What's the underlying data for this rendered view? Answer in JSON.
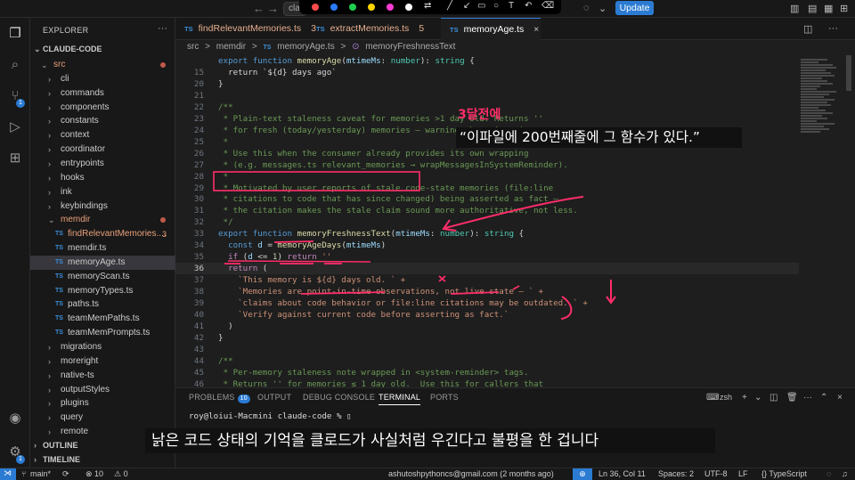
{
  "titlebar": {
    "search_value": "cla",
    "update_label": "Update",
    "annotation_colors": [
      "#ff4b4b",
      "#2b7bff",
      "#1fcf4f",
      "#ffd400",
      "#ff3bd4",
      "#ffffff"
    ],
    "nav_back": "←",
    "nav_forward": "→"
  },
  "activity": {
    "items": [
      {
        "icon": "explorer-icon",
        "glyph": "❐"
      },
      {
        "icon": "search-icon",
        "glyph": "⌕"
      },
      {
        "icon": "source-control-icon",
        "glyph": "⑂",
        "badge": "1"
      },
      {
        "icon": "run-debug-icon",
        "glyph": "▷"
      },
      {
        "icon": "extensions-icon",
        "glyph": "⊞"
      }
    ],
    "account_icon": "account-icon",
    "settings_icon": "gear-icon",
    "settings_badge": "1"
  },
  "explorer": {
    "header": "EXPLORER",
    "more": "···",
    "root": "CLAUDE-CODE",
    "items": [
      {
        "label": "src",
        "type": "folder",
        "open": true,
        "color": "#e8a07a",
        "dot": "#c05a4a"
      },
      {
        "label": "cli",
        "type": "folder"
      },
      {
        "label": "commands",
        "type": "folder"
      },
      {
        "label": "components",
        "type": "folder"
      },
      {
        "label": "constants",
        "type": "folder"
      },
      {
        "label": "context",
        "type": "folder"
      },
      {
        "label": "coordinator",
        "type": "folder"
      },
      {
        "label": "entrypoints",
        "type": "folder"
      },
      {
        "label": "hooks",
        "type": "folder"
      },
      {
        "label": "ink",
        "type": "folder"
      },
      {
        "label": "keybindings",
        "type": "folder"
      },
      {
        "label": "memdir",
        "type": "folder",
        "open": true,
        "color": "#e8a07a",
        "dot": "#c05a4a"
      },
      {
        "label": "findRelevantMemories....",
        "type": "file",
        "color": "#e8a07a",
        "mark": "3"
      },
      {
        "label": "memdir.ts",
        "type": "file"
      },
      {
        "label": "memoryAge.ts",
        "type": "file",
        "selected": true
      },
      {
        "label": "memoryScan.ts",
        "type": "file"
      },
      {
        "label": "memoryTypes.ts",
        "type": "file"
      },
      {
        "label": "paths.ts",
        "type": "file"
      },
      {
        "label": "teamMemPaths.ts",
        "type": "file"
      },
      {
        "label": "teamMemPrompts.ts",
        "type": "file"
      },
      {
        "label": "migrations",
        "type": "folder"
      },
      {
        "label": "moreright",
        "type": "folder"
      },
      {
        "label": "native-ts",
        "type": "folder"
      },
      {
        "label": "outputStyles",
        "type": "folder"
      },
      {
        "label": "plugins",
        "type": "folder"
      },
      {
        "label": "query",
        "type": "folder"
      },
      {
        "label": "remote",
        "type": "folder"
      }
    ],
    "file_badge": "TS",
    "outline": "OUTLINE",
    "timeline": "TIMELINE"
  },
  "tabs": [
    {
      "label": "findRelevantMemories.ts",
      "count": "3"
    },
    {
      "label": "extractMemories.ts",
      "count": "5"
    },
    {
      "label": "memoryAge.ts",
      "active": true,
      "close": "×"
    }
  ],
  "breadcrumb": [
    "src",
    ">",
    "memdir",
    ">",
    "TS",
    "memoryAge.ts",
    ">",
    "⊙",
    "memoryFreshnessText"
  ],
  "code": [
    {
      "n": "15",
      "t": [
        [
          "c-pl",
          "  return `${d} days ago`"
        ]
      ]
    },
    {
      "n": "20",
      "t": [
        [
          "c-pl",
          "}"
        ]
      ]
    },
    {
      "n": "21",
      "t": []
    },
    {
      "n": "22",
      "t": [
        [
          "c-cm",
          "/**"
        ]
      ]
    },
    {
      "n": "23",
      "t": [
        [
          "c-cm",
          " * Plain-text staleness caveat for memories >1 day old. Returns ''"
        ]
      ]
    },
    {
      "n": "24",
      "t": [
        [
          "c-cm",
          " * for fresh (today/yesterday) memories — warning there is noise."
        ]
      ]
    },
    {
      "n": "25",
      "t": [
        [
          "c-cm",
          " *"
        ]
      ]
    },
    {
      "n": "26",
      "t": [
        [
          "c-cm",
          " * Use this when the consumer already provides its own wrapping"
        ]
      ]
    },
    {
      "n": "27",
      "t": [
        [
          "c-cm",
          " * (e.g. messages.ts relevant_memories → wrapMessagesInSystemReminder)."
        ]
      ]
    },
    {
      "n": "28",
      "t": [
        [
          "c-cm",
          " *"
        ]
      ]
    },
    {
      "n": "29",
      "t": [
        [
          "c-cm",
          " * Motivated by user reports of stale code-state memories (file:line"
        ]
      ]
    },
    {
      "n": "30",
      "t": [
        [
          "c-cm",
          " * citations to code that has since changed) being asserted as fact —"
        ]
      ]
    },
    {
      "n": "31",
      "t": [
        [
          "c-cm",
          " * the citation makes the stale claim sound more authoritative, not less."
        ]
      ]
    },
    {
      "n": "32",
      "t": [
        [
          "c-cm",
          " */"
        ]
      ]
    },
    {
      "n": "33",
      "t": [
        [
          "c-kw",
          "export "
        ],
        [
          "c-kw",
          "function "
        ],
        [
          "c-fn",
          "memoryFreshnessText"
        ],
        [
          "c-pl",
          "("
        ],
        [
          "c-var",
          "mtimeMs"
        ],
        [
          "c-pl",
          ": "
        ],
        [
          "c-ty",
          "number"
        ],
        [
          "c-pl",
          "): "
        ],
        [
          "c-ty",
          "string"
        ],
        [
          "c-pl",
          " {"
        ]
      ]
    },
    {
      "n": "34",
      "t": [
        [
          "c-kw",
          "  const "
        ],
        [
          "c-var",
          "d"
        ],
        [
          "c-pl",
          " = "
        ],
        [
          "c-fn",
          "memoryAgeDays"
        ],
        [
          "c-pl",
          "("
        ],
        [
          "c-var",
          "mtimeMs"
        ],
        [
          "c-pl",
          ")"
        ]
      ]
    },
    {
      "n": "35",
      "t": [
        [
          "c-ct",
          "  if "
        ],
        [
          "c-pl",
          "("
        ],
        [
          "c-var",
          "d"
        ],
        [
          "c-pl",
          " <= "
        ],
        [
          "c-num",
          "1"
        ],
        [
          "c-pl",
          ") "
        ],
        [
          "c-ct",
          "return "
        ],
        [
          "c-str",
          "''"
        ]
      ]
    },
    {
      "n": "36",
      "cur": true,
      "t": [
        [
          "c-ct",
          "  return "
        ],
        [
          "c-pl",
          "("
        ]
      ]
    },
    {
      "n": "37",
      "t": [
        [
          "c-str",
          "    `This memory is ${d} days old. ` +"
        ]
      ]
    },
    {
      "n": "38",
      "t": [
        [
          "c-str",
          "    `Memories are point-in-time observations, not live state — ` +"
        ]
      ]
    },
    {
      "n": "39",
      "t": [
        [
          "c-str",
          "    `claims about code behavior or file:line citations may be outdated. ` +"
        ]
      ]
    },
    {
      "n": "40",
      "t": [
        [
          "c-str",
          "    `Verify against current code before asserting as fact.`"
        ]
      ]
    },
    {
      "n": "41",
      "t": [
        [
          "c-pl",
          "  )"
        ]
      ]
    },
    {
      "n": "42",
      "t": [
        [
          "c-pl",
          "}"
        ]
      ]
    },
    {
      "n": "43",
      "t": []
    },
    {
      "n": "44",
      "t": [
        [
          "c-cm",
          "/**"
        ]
      ]
    },
    {
      "n": "45",
      "t": [
        [
          "c-cm",
          " * Per-memory staleness note wrapped in <system-reminder> tags."
        ]
      ]
    },
    {
      "n": "46",
      "t": [
        [
          "c-cm",
          " * Returns '' for memories ≤ 1 day old.  Use this for callers that"
        ]
      ]
    }
  ],
  "code_top": {
    "n": "",
    "t": [
      [
        "c-kw",
        "export "
      ],
      [
        "c-kw",
        "function "
      ],
      [
        "c-fn",
        "memoryAge"
      ],
      [
        "c-pl",
        "("
      ],
      [
        "c-var",
        "mtimeMs"
      ],
      [
        "c-pl",
        ": "
      ],
      [
        "c-ty",
        "number"
      ],
      [
        "c-pl",
        "): "
      ],
      [
        "c-ty",
        "string"
      ],
      [
        "c-pl",
        " {"
      ]
    ]
  },
  "panel": {
    "tabs": [
      {
        "label": "PROBLEMS",
        "badge": "10"
      },
      {
        "label": "OUTPUT"
      },
      {
        "label": "DEBUG CONSOLE"
      },
      {
        "label": "TERMINAL",
        "active": true
      },
      {
        "label": "PORTS"
      }
    ],
    "shell": "zsh",
    "terminal_line": "roy@loiui-Macmini claude-code % ▯"
  },
  "statusbar": {
    "branch": "main*",
    "sync": "⟳",
    "errors": "⊗ 10",
    "warnings": "⚠ 0",
    "blame": "ashutoshpythoncs@gmail.com (2 months ago)",
    "position": "Ln 36, Col 11",
    "spaces": "Spaces: 2",
    "encoding": "UTF-8",
    "eol": "LF",
    "language": "{} TypeScript"
  },
  "overlays": {
    "red_label": "3달전에",
    "quote": "“이파일에 200번째줄에 그 함수가 있다.”",
    "subtitle": "낡은 코드 상태의 기억을 클로드가 사실처럼 우긴다고 불평을 한 겁니다"
  }
}
